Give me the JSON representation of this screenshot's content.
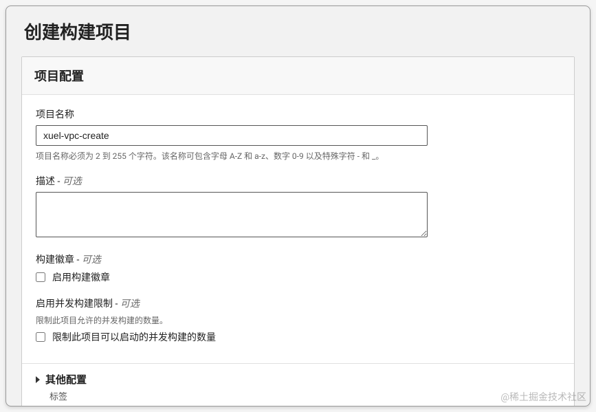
{
  "page": {
    "title": "创建构建项目"
  },
  "panel": {
    "header": "项目配置",
    "project_name": {
      "label": "项目名称",
      "value": "xuel-vpc-create",
      "hint": "项目名称必须为 2 到 255 个字符。该名称可包含字母 A-Z 和 a-z、数字 0-9 以及特殊字符 - 和 _。"
    },
    "description": {
      "label": "描述",
      "optional": "可选",
      "value": ""
    },
    "build_badge": {
      "label": "构建徽章",
      "optional": "可选",
      "checkbox_label": "启用构建徽章",
      "checked": false
    },
    "concurrent_limit": {
      "label": "启用并发构建限制",
      "optional": "可选",
      "hint": "限制此项目允许的并发构建的数量。",
      "checkbox_label": "限制此项目可以启动的并发构建的数量",
      "checked": false
    },
    "other_config": {
      "label": "其他配置",
      "sub": "标签"
    }
  },
  "watermark": "@稀土掘金技术社区",
  "sep": " - "
}
